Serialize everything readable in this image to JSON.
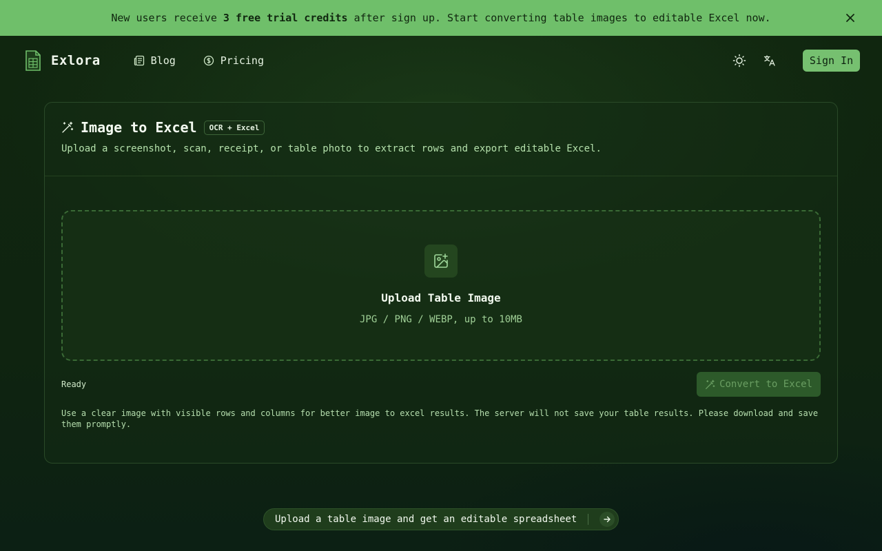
{
  "banner": {
    "text_before": "New users receive ",
    "highlight": "3 free trial credits",
    "text_after": " after sign up. Start converting table images to editable Excel now."
  },
  "header": {
    "brand": "Exlora",
    "nav": [
      {
        "label": "Blog",
        "icon": "newspaper-icon"
      },
      {
        "label": "Pricing",
        "icon": "dollar-circle-icon"
      }
    ],
    "sign_in_label": "Sign In"
  },
  "card": {
    "title": "Image to Excel",
    "badge": "OCR + Excel",
    "subtitle": "Upload a screenshot, scan, receipt, or table photo to extract rows and export editable Excel.",
    "dropzone": {
      "title": "Upload Table Image",
      "subtitle": "JPG / PNG / WEBP, up to 10MB"
    },
    "status": "Ready",
    "convert_label": "Convert to Excel",
    "hint": "Use a clear image with visible rows and columns for better image to excel results. The server will not save your table results. Please download and save them promptly."
  },
  "pill": {
    "text": "Upload a table image and get an editable spreadsheet"
  },
  "colors": {
    "banner_bg": "#6fbf6a",
    "accent": "#76c070",
    "background": "#0f2410"
  }
}
